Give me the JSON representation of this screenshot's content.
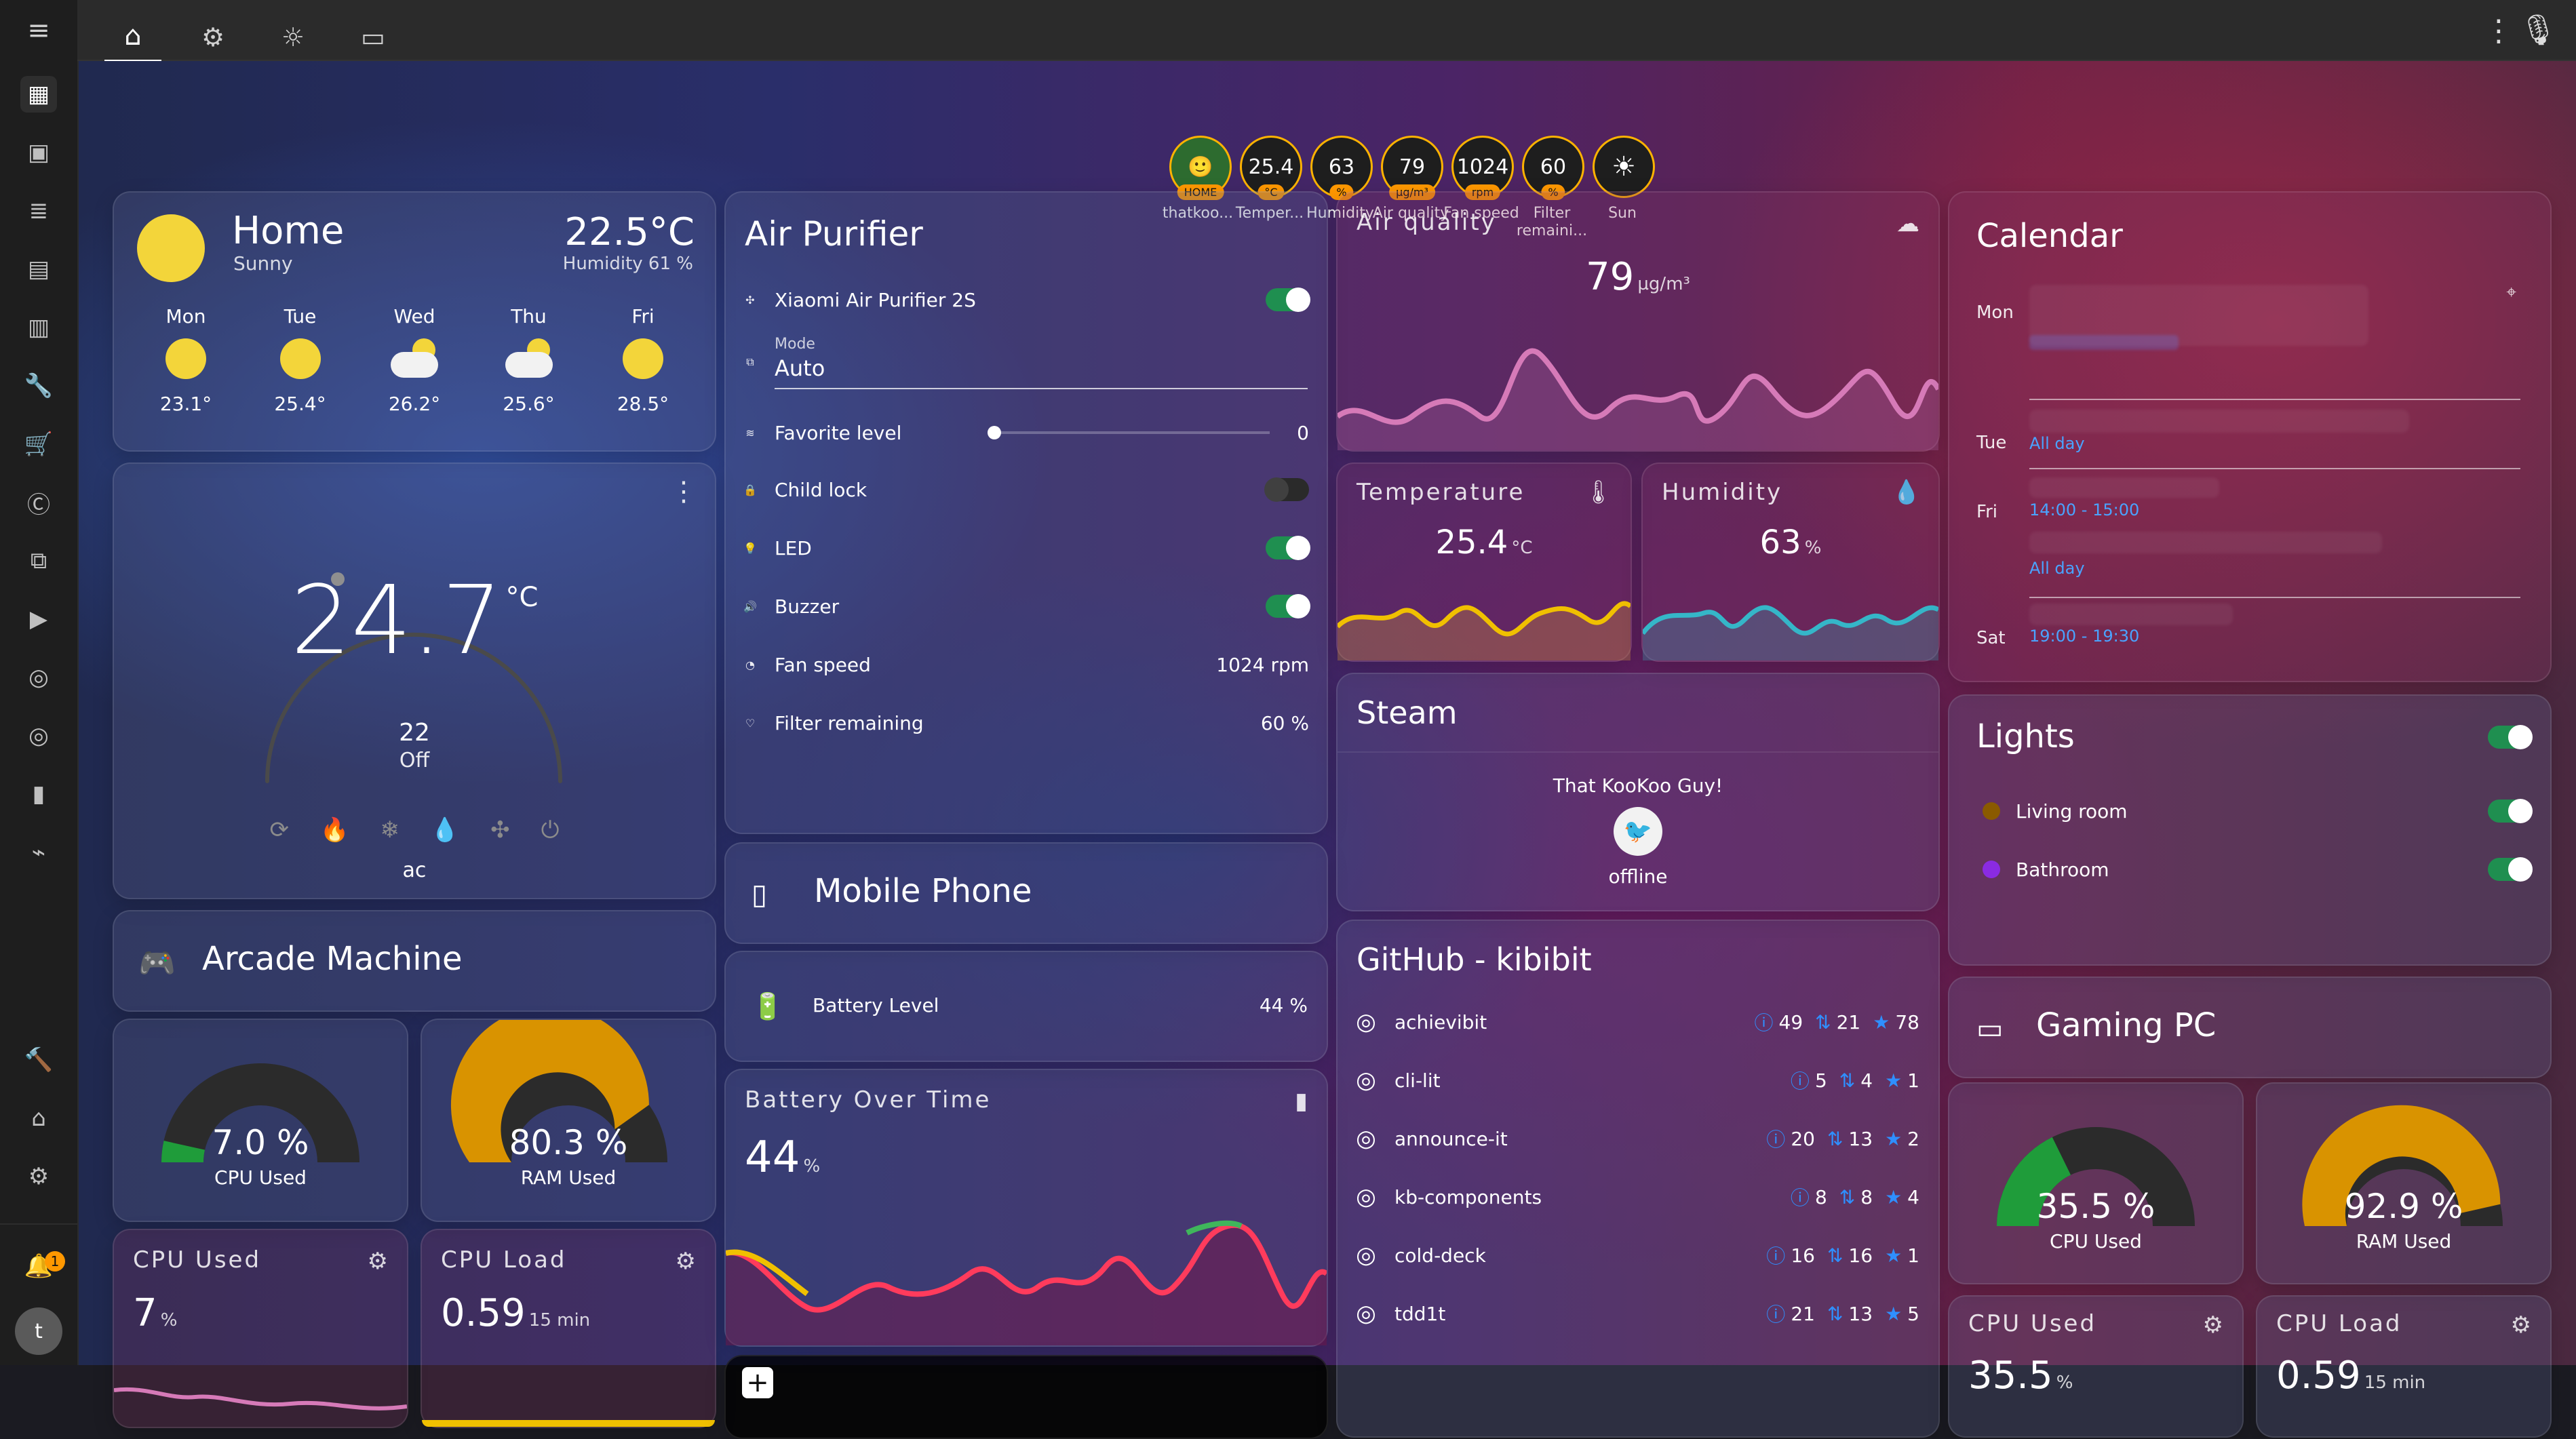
{
  "topbar": {
    "tabs": [
      {
        "name": "home",
        "active": true
      },
      {
        "name": "settings"
      },
      {
        "name": "lightbulb"
      },
      {
        "name": "monitor"
      }
    ]
  },
  "header_chips": [
    {
      "kind": "avatar",
      "badge": "HOME",
      "label": "thatkoo..."
    },
    {
      "value": "25.4",
      "unit": "°C",
      "label": "Temper..."
    },
    {
      "value": "63",
      "unit": "%",
      "label": "Humidity"
    },
    {
      "value": "79",
      "unit": "µg/m³",
      "label": "Air quality"
    },
    {
      "value": "1024",
      "unit": "rpm",
      "label": "Fan speed"
    },
    {
      "value": "60",
      "unit": "%",
      "label": "Filter remaini..."
    },
    {
      "kind": "sun",
      "label": "Sun"
    }
  ],
  "weather": {
    "title": "Home",
    "subtitle": "Sunny",
    "temp": "22.5°C",
    "humidity": "Humidity 61 %",
    "forecast": [
      {
        "day": "Mon",
        "temp": "23.1°",
        "icon": "sun"
      },
      {
        "day": "Tue",
        "temp": "25.4°",
        "icon": "sun"
      },
      {
        "day": "Wed",
        "temp": "26.2°",
        "icon": "cloud-sun"
      },
      {
        "day": "Thu",
        "temp": "25.6°",
        "icon": "cloud-sun"
      },
      {
        "day": "Fri",
        "temp": "28.5°",
        "icon": "sun"
      }
    ]
  },
  "thermostat": {
    "current": "24.7",
    "unit": "°C",
    "setpoint": "22",
    "mode": "Off",
    "name": "ac"
  },
  "arcade": {
    "title": "Arcade Machine",
    "cpu_used": {
      "value": "7.0 %",
      "label": "CPU Used",
      "percent": 7.0
    },
    "ram_used": {
      "value": "80.3 %",
      "label": "RAM Used",
      "percent": 80.3
    },
    "cpu_used_card": {
      "title": "CPU Used",
      "value": "7",
      "unit": "%"
    },
    "cpu_load_card": {
      "title": "CPU Load",
      "value": "0.59",
      "unit": "15 min"
    }
  },
  "air_purifier": {
    "title": "Air Purifier",
    "rows": [
      {
        "label": "Xiaomi Air Purifier 2S",
        "type": "toggle",
        "on": true
      },
      {
        "label": "Mode",
        "value": "Auto",
        "type": "select"
      },
      {
        "label": "Favorite level",
        "value": "0",
        "type": "slider",
        "level": 0
      },
      {
        "label": "Child lock",
        "type": "toggle",
        "on": false
      },
      {
        "label": "LED",
        "type": "toggle",
        "on": true
      },
      {
        "label": "Buzzer",
        "type": "toggle",
        "on": true
      },
      {
        "label": "Fan speed",
        "value": "1024 rpm",
        "type": "value"
      },
      {
        "label": "Filter remaining",
        "value": "60 %",
        "type": "value"
      }
    ]
  },
  "mobile_phone": {
    "title": "Mobile Phone",
    "battery_label": "Battery Level",
    "battery_value": "44 %"
  },
  "battery_over_time": {
    "title": "Battery Over Time",
    "value": "44",
    "unit": "%"
  },
  "air_quality": {
    "title": "Air quality",
    "value": "79",
    "unit": "µg/m³"
  },
  "temperature_card": {
    "title": "Temperature",
    "value": "25.4",
    "unit": "°C"
  },
  "humidity_card": {
    "title": "Humidity",
    "value": "63",
    "unit": "%"
  },
  "steam": {
    "title": "Steam",
    "user": "That KooKoo Guy!",
    "status": "offline"
  },
  "github": {
    "title": "GitHub - kibibit",
    "repos": [
      {
        "name": "achievibit",
        "issues": "49",
        "prs": "21",
        "stars": "78"
      },
      {
        "name": "cli-lit",
        "issues": "5",
        "prs": "4",
        "stars": "1"
      },
      {
        "name": "announce-it",
        "issues": "20",
        "prs": "13",
        "stars": "2"
      },
      {
        "name": "kb-components",
        "issues": "8",
        "prs": "8",
        "stars": "4"
      },
      {
        "name": "cold-deck",
        "issues": "16",
        "prs": "16",
        "stars": "1"
      },
      {
        "name": "tdd1t",
        "issues": "21",
        "prs": "13",
        "stars": "5"
      }
    ]
  },
  "calendar": {
    "title": "Calendar",
    "items": [
      {
        "day": "Mon",
        "time": "",
        "desc": ""
      },
      {
        "day": "Tue",
        "time": "All day",
        "desc": ""
      },
      {
        "day": "Fri",
        "time": "14:00 - 15:00",
        "desc": ""
      },
      {
        "day": "",
        "time": "All day",
        "desc": ""
      },
      {
        "day": "Sat",
        "time": "19:00 - 19:30",
        "desc": ""
      }
    ]
  },
  "lights": {
    "title": "Lights",
    "items": [
      {
        "label": "Living room",
        "on": true,
        "color": "#8a5a00"
      },
      {
        "label": "Bathroom",
        "on": true,
        "color": "#8a2be2"
      }
    ]
  },
  "gaming_pc": {
    "title": "Gaming PC",
    "cpu_used": {
      "value": "35.5 %",
      "label": "CPU Used",
      "percent": 35.5
    },
    "ram_used": {
      "value": "92.9 %",
      "label": "RAM Used",
      "percent": 92.9
    },
    "cpu_used_card": {
      "title": "CPU Used",
      "value": "35.5",
      "unit": "%"
    },
    "cpu_load_card": {
      "title": "CPU Load",
      "value": "0.59",
      "unit": "15 min"
    }
  },
  "colors": {
    "accent_orange": "#ffb300",
    "green": "#1f8f50",
    "pink_line": "#d67ab8",
    "yellow_line": "#f0c000",
    "teal_line": "#35b6c8",
    "battery_red": "#ff3b5c",
    "github_blue": "#2f8fff"
  }
}
